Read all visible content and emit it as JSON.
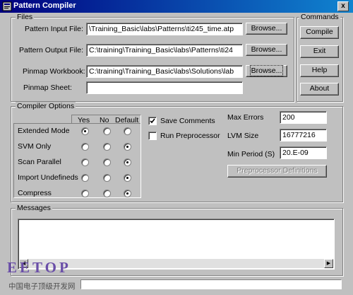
{
  "window": {
    "title": "Pattern Compiler",
    "close_glyph": "x"
  },
  "files": {
    "group_title": "Files",
    "pattern_input": {
      "label": "Pattern Input File:",
      "value": "\\Training_Basic\\labs\\Patterns\\ti245_time.atp",
      "browse": "Browse..."
    },
    "pattern_output": {
      "label": "Pattern Output File:",
      "value": "C:\\training\\Training_Basic\\labs\\Patterns\\ti24",
      "browse": "Browse..."
    },
    "pinmap_workbook": {
      "label": "Pinmap Workbook:",
      "value": "C:\\training\\Training_Basic\\labs\\Solutions\\lab",
      "browse": "Browse..."
    },
    "pinmap_sheet": {
      "label": "Pinmap Sheet:",
      "value": ""
    }
  },
  "commands": {
    "group_title": "Commands",
    "buttons": [
      "Compile",
      "Exit",
      "Help",
      "About"
    ]
  },
  "compiler_options": {
    "group_title": "Compiler Options",
    "columns": [
      "Yes",
      "No",
      "Default"
    ],
    "rows": [
      {
        "label": "Extended Mode",
        "selected": "Yes"
      },
      {
        "label": "SVM Only",
        "selected": "Default"
      },
      {
        "label": "Scan Parallel",
        "selected": "Default"
      },
      {
        "label": "Import Undefineds",
        "selected": "Default"
      },
      {
        "label": "Compress",
        "selected": "Default"
      }
    ],
    "save_comments": {
      "label": "Save Comments",
      "checked": true
    },
    "run_preprocessor": {
      "label": "Run Preprocessor",
      "checked": false
    },
    "max_errors": {
      "label": "Max Errors",
      "value": "200"
    },
    "lvm_size": {
      "label": "LVM Size",
      "value": "16777216"
    },
    "min_period": {
      "label": "Min Period (S)",
      "value": "20.E-09"
    },
    "preprocessor_definitions": "Preprocessor Definitions"
  },
  "messages": {
    "group_title": "Messages",
    "content": ""
  },
  "watermark": {
    "logo": "EETOP",
    "caption": "中国电子顶级开发网"
  }
}
